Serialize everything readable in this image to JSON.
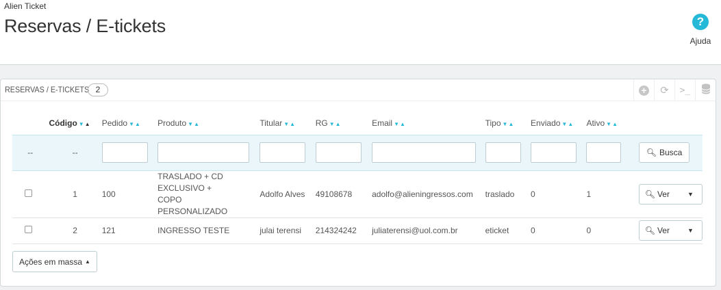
{
  "header": {
    "breadcrumb": "Alien Ticket",
    "title": "Reservas / E-tickets",
    "help_label": "Ajuda"
  },
  "panel": {
    "title": "Reservas / E-tickets",
    "count": "2",
    "tools": [
      "add-icon",
      "refresh-icon",
      "terminal-icon",
      "database-icon"
    ]
  },
  "table": {
    "columns": [
      "Código",
      "Pedido",
      "Produto",
      "Titular",
      "RG",
      "Email",
      "Tipo",
      "Enviado",
      "Ativo"
    ],
    "filter": {
      "placeholder_1": "--",
      "placeholder_2": "--",
      "search_label": "Busca"
    },
    "rows": [
      {
        "codigo": "1",
        "pedido": "100",
        "produto": "TRASLADO + CD EXCLUSIVO + COPO PERSONALIZADO",
        "titular": "Adolfo Alves",
        "rg": "49108678",
        "email": "adolfo@alieningressos.com",
        "tipo": "traslado",
        "enviado": "0",
        "ativo": "1",
        "action": "Ver"
      },
      {
        "codigo": "2",
        "pedido": "121",
        "produto": "INGRESSO TESTE",
        "titular": "julai terensi",
        "rg": "214324242",
        "email": "juliaterensi@uol.com.br",
        "tipo": "eticket",
        "enviado": "0",
        "ativo": "0",
        "action": "Ver"
      }
    ]
  },
  "bulk_actions_label": "Ações em massa",
  "colors": {
    "accent": "#25b9d7",
    "filter_bg": "#ebf6fa"
  }
}
